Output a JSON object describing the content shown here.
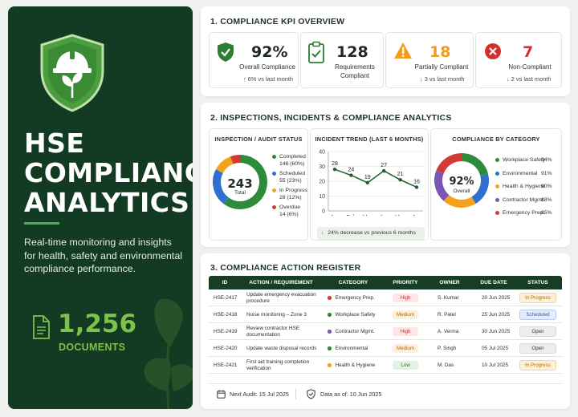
{
  "hero": {
    "title_lines": [
      "HSE",
      "COMPLIANCE",
      "ANALYTICS"
    ],
    "description": "Real-time monitoring and insights for health, safety and environmental compliance performance.",
    "documents_count": "1,256",
    "documents_label": "DOCUMENTS"
  },
  "kpi": {
    "title": "1. COMPLIANCE KPI OVERVIEW",
    "items": [
      {
        "value": "92%",
        "label": "Overall Compliance",
        "delta": "6% vs last month",
        "arrow": "↑",
        "color": "#2e7d32",
        "icon": "shield-check-icon"
      },
      {
        "value": "128",
        "label": "Requirements Compliant",
        "delta": "",
        "arrow": "",
        "color": "#2e7d32",
        "icon": "clipboard-check-icon"
      },
      {
        "value": "18",
        "label": "Partially Compliant",
        "delta": "3 vs last month",
        "arrow": "↓",
        "color": "#f29b1d",
        "icon": "warning-icon"
      },
      {
        "value": "7",
        "label": "Non-Compliant",
        "delta": "2 vs last month",
        "arrow": "↓",
        "color": "#d32f2f",
        "icon": "x-circle-icon"
      }
    ]
  },
  "analytics": {
    "title": "2. INSPECTIONS, INCIDENTS & COMPLIANCE ANALYTICS",
    "inspection": {
      "title": "INSPECTION / AUDIT STATUS",
      "total": "243",
      "total_label": "Total",
      "items": [
        {
          "name": "Completed",
          "value": "146 (60%)",
          "color": "#2e8b3a"
        },
        {
          "name": "Scheduled",
          "value": "55 (23%)",
          "color": "#2f6fd0"
        },
        {
          "name": "In Progress",
          "value": "28 (12%)",
          "color": "#f4a21d"
        },
        {
          "name": "Overdue",
          "value": "14 (6%)",
          "color": "#d23b35"
        }
      ]
    },
    "trend": {
      "title": "INCIDENT TREND (LAST 6 MONTHS)",
      "note": "24% decrease vs previous 6 months",
      "note_arrow": "↓"
    },
    "category": {
      "title": "COMPLIANCE BY CATEGORY",
      "center": "92%",
      "center_label": "Overall",
      "items": [
        {
          "name": "Workplace Safety",
          "value": "94%",
          "color": "#2e8b3a"
        },
        {
          "name": "Environmental",
          "value": "91%",
          "color": "#2f6fd0"
        },
        {
          "name": "Health & Hygiene",
          "value": "90%",
          "color": "#f4a21d"
        },
        {
          "name": "Contractor Mgmt.",
          "value": "88%",
          "color": "#7b55b8"
        },
        {
          "name": "Emergency Prep.",
          "value": "85%",
          "color": "#d23b35"
        }
      ]
    }
  },
  "chart_data": [
    {
      "type": "pie",
      "title": "INSPECTION / AUDIT STATUS",
      "categories": [
        "Completed",
        "Scheduled",
        "In Progress",
        "Overdue"
      ],
      "values": [
        146,
        55,
        28,
        14
      ]
    },
    {
      "type": "line",
      "title": "INCIDENT TREND (LAST 6 MONTHS)",
      "categories": [
        "Jan",
        "Feb",
        "Mar",
        "Apr",
        "May",
        "Jun"
      ],
      "values": [
        28,
        24,
        19,
        27,
        21,
        16
      ],
      "ylim": [
        0,
        40
      ],
      "yticks": [
        0,
        10,
        20,
        30,
        40
      ],
      "grid": true
    },
    {
      "type": "pie",
      "title": "COMPLIANCE BY CATEGORY",
      "categories": [
        "Workplace Safety",
        "Environmental",
        "Health & Hygiene",
        "Contractor Mgmt.",
        "Emergency Prep."
      ],
      "values": [
        94,
        91,
        90,
        88,
        85
      ]
    }
  ],
  "register": {
    "title": "3. COMPLIANCE ACTION REGISTER",
    "headers": [
      "ID",
      "ACTION / REQUIREMENT",
      "CATEGORY",
      "PRIORITY",
      "OWNER",
      "DUE DATE",
      "STATUS"
    ],
    "rows": [
      {
        "id": "HSE-2417",
        "action": "Update emergency evacuation procedure",
        "category": "Emergency Prep.",
        "cat_color": "#d23b35",
        "priority": "High",
        "owner": "S. Kumar",
        "due": "20 Jun 2025",
        "status": "In Progress"
      },
      {
        "id": "HSE-2418",
        "action": "Noise monitoring – Zone 3",
        "category": "Workplace Safety",
        "cat_color": "#2e8b3a",
        "priority": "Medium",
        "owner": "R. Patel",
        "due": "25 Jun 2025",
        "status": "Scheduled"
      },
      {
        "id": "HSE-2419",
        "action": "Review contractor HSE documentation",
        "category": "Contractor Mgmt.",
        "cat_color": "#7b55b8",
        "priority": "High",
        "owner": "A. Verma",
        "due": "30 Jun 2025",
        "status": "Open"
      },
      {
        "id": "HSE-2420",
        "action": "Update waste disposal records",
        "category": "Environmental",
        "cat_color": "#2e8b3a",
        "priority": "Medium",
        "owner": "P. Singh",
        "due": "05 Jul 2025",
        "status": "Open"
      },
      {
        "id": "HSE-2421",
        "action": "First aid training completion verification",
        "category": "Health & Hygiene",
        "cat_color": "#f4a21d",
        "priority": "Low",
        "owner": "M. Das",
        "due": "10 Jul 2025",
        "status": "In Progress"
      }
    ],
    "footer": {
      "next_audit": "Next Audit: 15 Jul 2025",
      "data_as_of": "Data as of: 10 Jun 2025"
    }
  }
}
